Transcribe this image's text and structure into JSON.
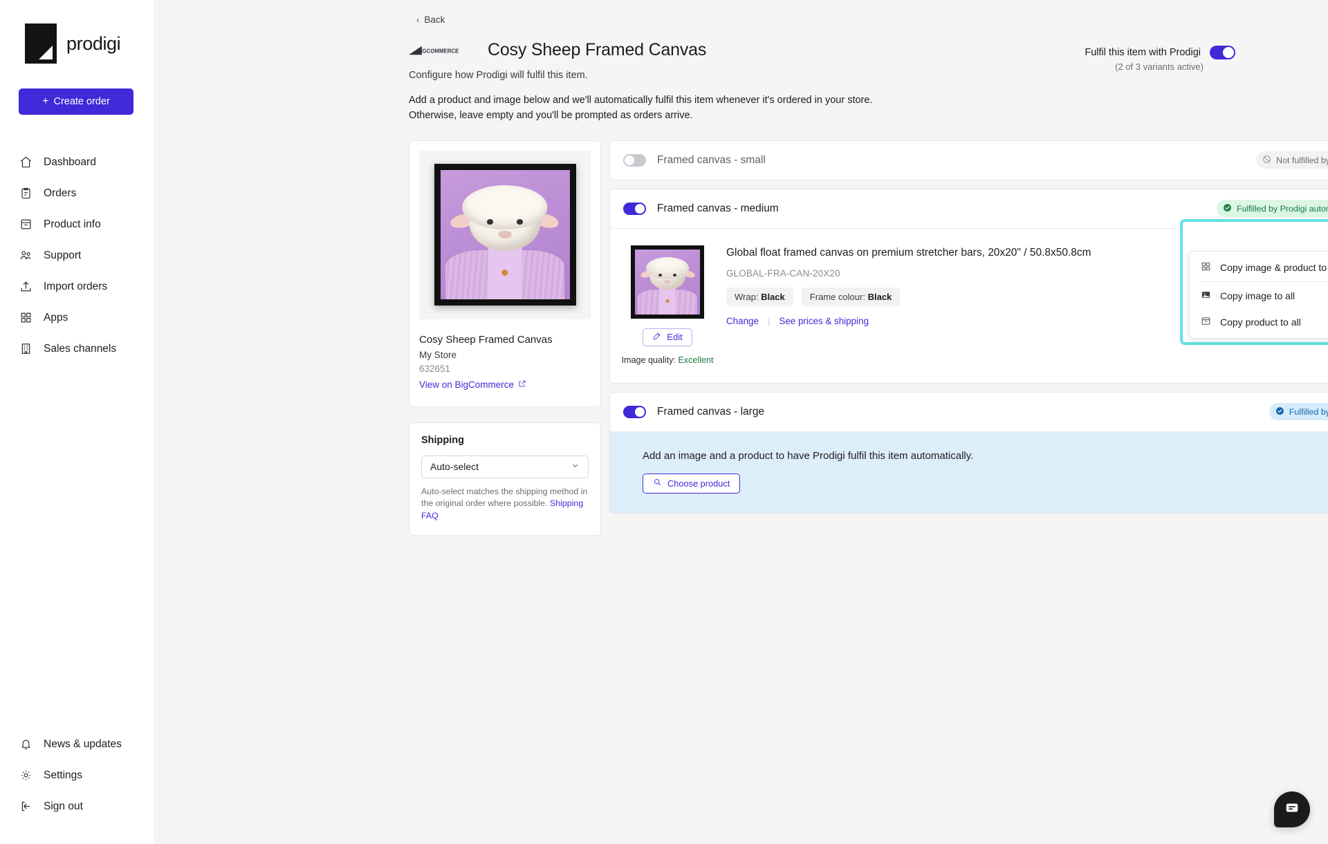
{
  "brand": {
    "name": "prodigi",
    "logo_icon": "prodigi-logo"
  },
  "sidebar": {
    "create_order_label": "Create order",
    "items": [
      {
        "label": "Dashboard",
        "icon": "home-icon"
      },
      {
        "label": "Orders",
        "icon": "clipboard-icon"
      },
      {
        "label": "Product info",
        "icon": "archive-box-icon"
      },
      {
        "label": "Support",
        "icon": "users-icon"
      },
      {
        "label": "Import orders",
        "icon": "upload-icon"
      },
      {
        "label": "Apps",
        "icon": "grid-icon"
      },
      {
        "label": "Sales channels",
        "icon": "building-icon"
      }
    ],
    "bottom_items": [
      {
        "label": "News & updates",
        "icon": "bell-icon"
      },
      {
        "label": "Settings",
        "icon": "gear-icon"
      },
      {
        "label": "Sign out",
        "icon": "sign-out-icon"
      }
    ]
  },
  "header": {
    "back_label": "Back",
    "store_logo_text": "BIGCOMMERCE",
    "title": "Cosy Sheep Framed Canvas",
    "subtitle": "Configure how Prodigi will fulfil this item.",
    "blurb_line1": "Add a product and image below and we'll automatically fulfil this item whenever it's ordered in your store.",
    "blurb_line2": "Otherwise, leave empty and you'll be prompted as orders arrive.",
    "fulfil_toggle_label": "Fulfil this item with Prodigi",
    "fulfil_toggle_state": "on",
    "variants_active_text": "(2 of 3 variants active)"
  },
  "product_card": {
    "image_alt": "Framed canvas of a sheep in a purple knitted cardigan",
    "name": "Cosy Sheep Framed Canvas",
    "store": "My Store",
    "sku": "632651",
    "link_label": "View on BigCommerce",
    "link_icon": "external-link-icon"
  },
  "shipping_card": {
    "title": "Shipping",
    "select_value": "Auto-select",
    "select_options": [
      "Auto-select"
    ],
    "hint_text": "Auto-select matches the shipping method in the original order where possible.",
    "hint_link": "Shipping FAQ"
  },
  "variants": [
    {
      "name": "Framed canvas - small",
      "toggle_state": "off",
      "status_label": "Not fulfilled by Prodigi",
      "status_style": "neutral",
      "status_icon": "no-entry-icon",
      "expanded": false
    },
    {
      "name": "Framed canvas - medium",
      "toggle_state": "on",
      "status_label": "Fulfilled by Prodigi automatically",
      "status_style": "green",
      "status_icon": "check-circle-icon",
      "expanded": true,
      "detail": {
        "title": "Global float framed canvas on premium stretcher bars, 20x20\" / 50.8x50.8cm",
        "sku": "GLOBAL-FRA-CAN-20X20",
        "chips": [
          {
            "label": "Wrap:",
            "value": "Black"
          },
          {
            "label": "Frame colour:",
            "value": "Black"
          }
        ],
        "change_label": "Change",
        "prices_label": "See prices & shipping",
        "edit_label": "Edit",
        "edit_icon": "pencil-square-icon",
        "image_quality_label": "Image quality:",
        "image_quality_value": "Excellent"
      }
    },
    {
      "name": "Framed canvas - large",
      "toggle_state": "on",
      "status_label": "Fulfilled by Prodigi",
      "status_style": "blue",
      "status_icon": "check-circle-icon",
      "expanded": true,
      "empty_state": {
        "text": "Add an image and a product to have Prodigi fulfil this item automatically.",
        "button_label": "Choose product",
        "button_icon": "search-icon"
      }
    }
  ],
  "overflow_menu": {
    "trigger_icon": "ellipsis-icon",
    "trigger_label": "···",
    "items": [
      {
        "label": "Copy image & product to all",
        "icon": "grid-icon"
      },
      {
        "label": "Copy image to all",
        "icon": "image-icon"
      },
      {
        "label": "Copy product to all",
        "icon": "archive-box-icon"
      }
    ],
    "highlight_color": "#62e1e3"
  },
  "chat": {
    "icon": "chat-bubble-icon"
  },
  "colors": {
    "accent": "#4029d9",
    "green": "#177a40",
    "green_bg": "#dcf6e4",
    "blue": "#1565b0",
    "blue_bg": "#d6ecfb",
    "empty_bg": "#ddeefb",
    "highlight": "#62e1e3",
    "page_bg": "#f5f5f6"
  }
}
